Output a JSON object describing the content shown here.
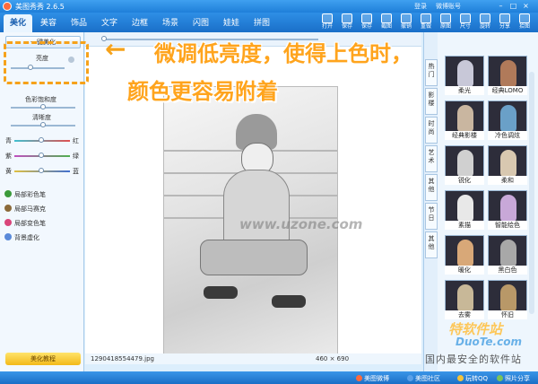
{
  "app": {
    "title": "美图秀秀 2.6.5",
    "user_line1": "登录",
    "user_line2": "微博账号",
    "win_buttons": [
      "–",
      "□",
      "×"
    ]
  },
  "tabs": [
    {
      "label": "美化",
      "active": true
    },
    {
      "label": "美容"
    },
    {
      "label": "饰品"
    },
    {
      "label": "文字"
    },
    {
      "label": "边框"
    },
    {
      "label": "场景"
    },
    {
      "label": "闪图"
    },
    {
      "label": "娃娃"
    },
    {
      "label": "拼图"
    }
  ],
  "toolbar": [
    "打开",
    "保存",
    "保存",
    "截图",
    "撤销",
    "重做",
    "原图",
    "尺寸",
    "旋转",
    "分享",
    "拾图"
  ],
  "left_panel": {
    "one_click_button": "一键美化",
    "sliders": [
      {
        "label": "亮度",
        "value": 0.35
      },
      {
        "label": "色彩饱和度",
        "value": 0.5
      },
      {
        "label": "清晰度",
        "value": 0.5
      }
    ],
    "color_sliders": [
      {
        "left": "青",
        "right": "红",
        "value": 0.5
      },
      {
        "left": "紫",
        "right": "绿",
        "value": 0.5
      },
      {
        "left": "黄",
        "right": "蓝",
        "value": 0.5
      }
    ],
    "brushes": [
      {
        "label": "局部彩色笔",
        "color": "#3a9a3a"
      },
      {
        "label": "局部马赛克",
        "color": "#8b6a3a"
      },
      {
        "label": "局部变色笔",
        "color": "#d9457a"
      },
      {
        "label": "背景虚化",
        "color": "#5a8ad9"
      }
    ],
    "tips_button": "美化教程"
  },
  "annotation": {
    "line1": "微调低亮度，使得上色时，",
    "line2": "颜色更容易附着",
    "color": "#ffa41d"
  },
  "canvas": {
    "watermark": "www.uzone.com",
    "filename": "1290418554479.jpg",
    "dimensions": "460 × 690"
  },
  "right_tabs": [
    "热门",
    "影楼",
    "时尚",
    "艺术",
    "其他",
    "节日",
    "其他"
  ],
  "effects": [
    {
      "label": "柔光",
      "tint": "#c8c8d8"
    },
    {
      "label": "经典LOMO",
      "tint": "#b07a5a"
    },
    {
      "label": "经典影楼",
      "tint": "#c9b6a0"
    },
    {
      "label": "冷色调炫",
      "tint": "#6aa0c8"
    },
    {
      "label": "锐化",
      "tint": "#d0d0d0"
    },
    {
      "label": "柔和",
      "tint": "#d8c8b0"
    },
    {
      "label": "素描",
      "tint": "#e8e8e8"
    },
    {
      "label": "智能绘色",
      "tint": "#c8a8d8"
    },
    {
      "label": "暖化",
      "tint": "#d8a878"
    },
    {
      "label": "黑白色",
      "tint": "#a8a8a8"
    },
    {
      "label": "去雾",
      "tint": "#c8b898"
    },
    {
      "label": "怀旧",
      "tint": "#b89868"
    }
  ],
  "bottom": {
    "links": [
      "美图微博",
      "美图社区",
      "玩转QQ",
      "照片分享"
    ],
    "site_mark_1": "特软件站",
    "site_mark_2": "DuoTe.com",
    "site_mark_3": "国内最安全的软件站"
  }
}
